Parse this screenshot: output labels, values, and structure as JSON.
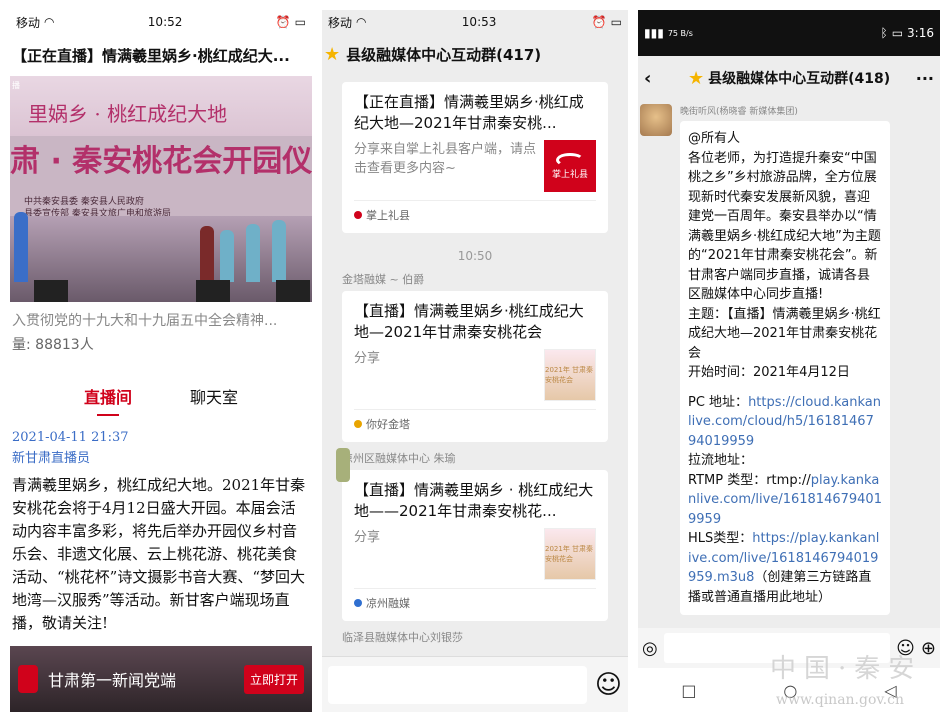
{
  "phone1": {
    "status": {
      "carrier": "移动",
      "time": "10:52"
    },
    "title": "【正在直播】情满羲里娲乡·桃红成纪大...",
    "video": {
      "line1": "里娲乡 · 桃红成纪大地",
      "line2": "肃 · 秦安桃花会开园仪式",
      "org1": "中共秦安县委  秦安县人民政府",
      "org2": "县委宣传部  秦安县文旅广电和旅游局"
    },
    "summary": "入贯彻党的十九大和十九届五中全会精神...",
    "viewers": "量: 88813人",
    "tabs": [
      {
        "label": "直播间"
      },
      {
        "label": "聊天室"
      }
    ],
    "feed": {
      "date": "2021-04-11 21:37",
      "author": "新甘肃直播员",
      "body": "青满羲里娲乡，桃红成纪大地。2021年甘秦安桃花会将于4月12日盛大开园。本届会活动内容丰富多彩，将先后举办开园仪乡村音乐会、非遗文化展、云上桃花游、桃花美食活动、“桃花杯”诗文摄影书音大赛、“梦回大地湾—汉服秀”等活动。新甘客户端现场直播，敬请关注!"
    },
    "bottom_bar": {
      "app_name": "甘肃第一新闻党端",
      "open_label": "立即打开"
    }
  },
  "phone2": {
    "status": {
      "carrier": "移动",
      "time": "10:53"
    },
    "group_title": "县级融媒体中心互动群(417)",
    "messages": [
      {
        "sender": "",
        "title": "【正在直播】情满羲里娲乡·桃红成纪大地—2021年甘肃秦安桃...",
        "desc": "分享来自掌上礼县客户端，请点击查看更多内容~",
        "thumb_text": "掌上礼县",
        "source": "掌上礼县"
      },
      {
        "sender": "金塔融媒 ~ 伯爵",
        "title": "【直播】情满羲里娲乡·桃红成纪大地—2021年甘肃秦安桃花会",
        "desc": "分享",
        "thumb_text": "2021年 甘肃秦安桃花会",
        "source": "你好金塔"
      },
      {
        "sender": "凉州区融媒体中心 朱瑜",
        "title": "【直播】情满羲里娲乡 · 桃红成纪大地——2021年甘肃秦安桃花...",
        "desc": "分享",
        "thumb_text": "2021年 甘肃秦安桃花会",
        "source": "凉州融媒"
      }
    ],
    "timestamp": "10:50",
    "last_sender": "临泽县融媒体中心刘银莎"
  },
  "phone3": {
    "status": {
      "time": "3:16",
      "speed": "75 B/s"
    },
    "group_title": "县级融媒体中心互动群(418)",
    "message": {
      "sender": "晚街听风(杨晓睿 新媒体集团)",
      "mention": "@所有人",
      "intro": "各位老师，为打造提升秦安“中国桃之乡”乡村旅游品牌，全方位展现新时代秦安发展新风貌，喜迎建党一百周年。秦安县举办以“情满羲里娲乡·桃红成纪大地”为主题的“2021年甘肃秦安桃花会”。新甘肃客户端同步直播，诚请各县区融媒体中心同步直播!",
      "topic": "主题：【直播】情满羲里娲乡·桃红成纪大地—2021年甘肃秦安桃花会",
      "start": "开始时间：2021年4月12日",
      "pc_label": "PC 地址：",
      "pc_url": "https://cloud.kankanlive.com/cloud/h5/1618146794019959",
      "pull_label": "拉流地址：",
      "rtmp_label": "RTMP 类型：rtmp://",
      "rtmp_url": "play.kankanlive.com/live/1618146794019959",
      "hls_label": "HLS类型：",
      "hls_url": "https://play.kankanlive.com/live/1618146794019959.m3u8",
      "hls_note": "（创建第三方链路直播或普通直播用此地址）"
    }
  },
  "watermark": {
    "text": "中国·秦安",
    "url": "www.qinan.gov.cn"
  }
}
